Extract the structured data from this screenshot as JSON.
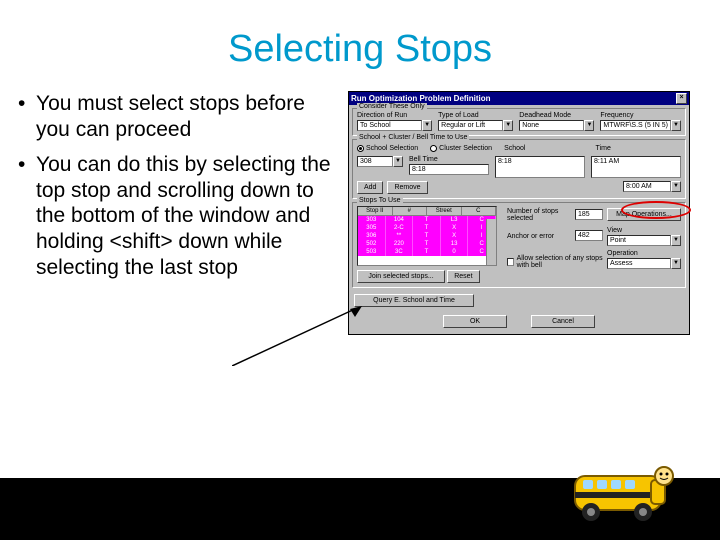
{
  "title": "Selecting Stops",
  "bullets": [
    "You must select stops before you can proceed",
    "You can do this by selecting the top stop and scrolling down to the bottom of the window and holding <shift> down while selecting the last stop"
  ],
  "dialog": {
    "title": "Run Optimization Problem Definition",
    "close_x": "×",
    "section1": {
      "title": "Consider These Only",
      "labels": {
        "direction": "Direction of Run",
        "typeload": "Type of Load",
        "deadhead": "Deadhead Mode",
        "frequency": "Frequency"
      },
      "values": {
        "direction": "To School",
        "typeload": "Regular or Lift",
        "deadhead": "None",
        "frequency": "MTWRF\\S.S (5 IN 5)"
      }
    },
    "section2": {
      "title": "School + Cluster / Bell Time to Use",
      "radios": {
        "schoolselect": "School Selection",
        "clusterselect": "Cluster Selection"
      },
      "labels": {
        "school": "School",
        "belltime": "Bell Time",
        "time": "Time"
      },
      "values": {
        "code": "308",
        "school": "",
        "belltime": "8:18",
        "time": "8:11 AM",
        "time2": "8:00 AM"
      },
      "btns": {
        "add": "Add",
        "remove": "Remove"
      }
    },
    "section3": {
      "title": "Stops To Use",
      "table": {
        "headers": [
          "Stop II",
          "#",
          "Street",
          "C"
        ],
        "rows": [
          [
            "303",
            "104",
            "T",
            "L3",
            "C"
          ],
          [
            "305",
            "2-C",
            "T",
            "X",
            "I"
          ],
          [
            "306",
            "**",
            "T",
            "X",
            "I"
          ],
          [
            "502",
            "220",
            "T",
            "13",
            "C"
          ],
          [
            "503",
            "3C",
            "T",
            "0",
            "C"
          ]
        ]
      },
      "labels": {
        "numstops": "Number of stops selected",
        "anchor": "Anchor or error",
        "join": "Join selected stops...",
        "view": "View",
        "operation": "Operation",
        "allow": "Allow selection of any stops with bell"
      },
      "values": {
        "numstops": "185",
        "anchor": "482",
        "view": "Point",
        "operation": "Assess"
      },
      "btns": {
        "mapops": "Map Operations...",
        "reset": "Reset"
      }
    },
    "querybtn": "Query E. School and Time",
    "ok": "OK",
    "cancel": "Cancel"
  }
}
